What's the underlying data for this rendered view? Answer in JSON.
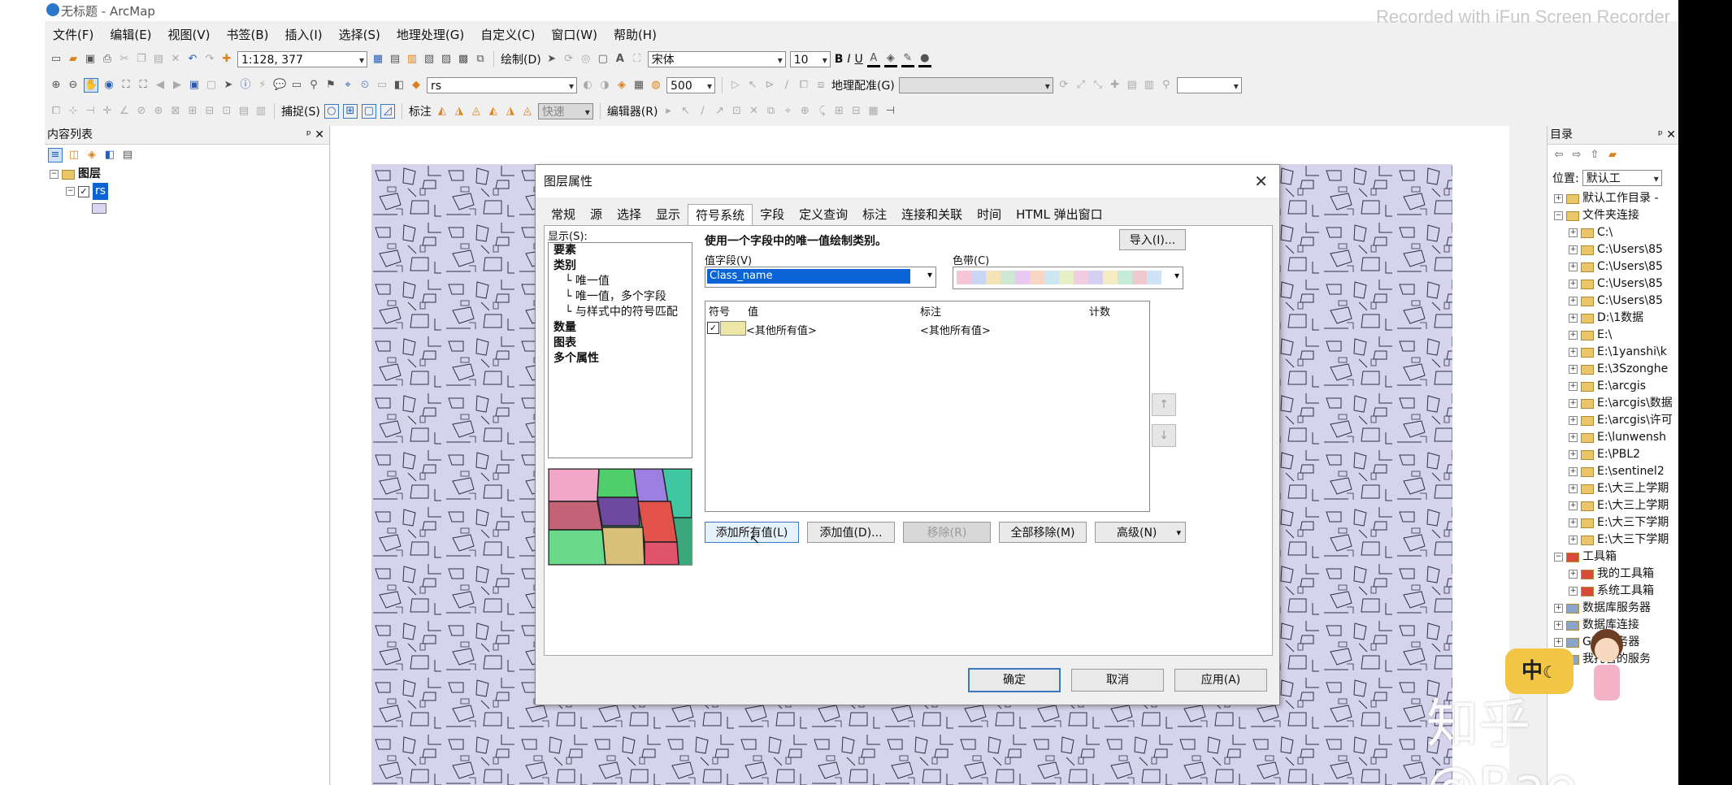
{
  "window": {
    "title": "无标题 - ArcMap",
    "recorder_watermark": "Recorded with iFun Screen Recorder"
  },
  "menu": [
    "文件(F)",
    "编辑(E)",
    "视图(V)",
    "书签(B)",
    "插入(I)",
    "选择(S)",
    "地理处理(G)",
    "自定义(C)",
    "窗口(W)",
    "帮助(H)"
  ],
  "toolbar": {
    "scale": "1:128, 377",
    "draw_label": "绘制(D)",
    "font_name": "宋体",
    "font_size": "10",
    "bold": "B",
    "italic": "I",
    "underline": "U",
    "layer_combo": "rs",
    "resolution": "500",
    "georef_label": "地理配准(G)",
    "snap_label": "捕捉(S)",
    "label_label": "标注",
    "quick_label": "快速",
    "editor_label": "编辑器(R)"
  },
  "toc": {
    "title": "内容列表",
    "root": "图层",
    "layer": "rs"
  },
  "catalog": {
    "title": "目录",
    "location_label": "位置:",
    "location_value": "默认工",
    "items": [
      {
        "label": "默认工作目录 -",
        "level": 0,
        "type": "home"
      },
      {
        "label": "文件夹连接",
        "level": 0,
        "type": "folder",
        "expanded": true
      },
      {
        "label": "C:\\",
        "level": 1,
        "type": "folder"
      },
      {
        "label": "C:\\Users\\85",
        "level": 1,
        "type": "folder"
      },
      {
        "label": "C:\\Users\\85",
        "level": 1,
        "type": "folder"
      },
      {
        "label": "C:\\Users\\85",
        "level": 1,
        "type": "folder"
      },
      {
        "label": "C:\\Users\\85",
        "level": 1,
        "type": "folder"
      },
      {
        "label": "D:\\1数据",
        "level": 1,
        "type": "folder"
      },
      {
        "label": "E:\\",
        "level": 1,
        "type": "folder"
      },
      {
        "label": "E:\\1yanshi\\k",
        "level": 1,
        "type": "folder"
      },
      {
        "label": "E:\\3Szonghe",
        "level": 1,
        "type": "folder"
      },
      {
        "label": "E:\\arcgis",
        "level": 1,
        "type": "folder"
      },
      {
        "label": "E:\\arcgis\\数据",
        "level": 1,
        "type": "folder"
      },
      {
        "label": "E:\\arcgis\\许可",
        "level": 1,
        "type": "folder"
      },
      {
        "label": "E:\\lunwensh",
        "level": 1,
        "type": "folder"
      },
      {
        "label": "E:\\PBL2",
        "level": 1,
        "type": "folder"
      },
      {
        "label": "E:\\sentinel2",
        "level": 1,
        "type": "folder"
      },
      {
        "label": "E:\\大三上学期",
        "level": 1,
        "type": "folder"
      },
      {
        "label": "E:\\大三上学期",
        "level": 1,
        "type": "folder"
      },
      {
        "label": "E:\\大三下学期",
        "level": 1,
        "type": "folder"
      },
      {
        "label": "E:\\大三下学期",
        "level": 1,
        "type": "folder"
      },
      {
        "label": "工具箱",
        "level": 0,
        "type": "toolbox",
        "expanded": true
      },
      {
        "label": "我的工具箱",
        "level": 1,
        "type": "toolbox"
      },
      {
        "label": "系统工具箱",
        "level": 1,
        "type": "toolbox"
      },
      {
        "label": "数据库服务器",
        "level": 0,
        "type": "db"
      },
      {
        "label": "数据库连接",
        "level": 0,
        "type": "db"
      },
      {
        "label": "GIS 服务器",
        "level": 0,
        "type": "db"
      },
      {
        "label": "我托管的服务",
        "level": 0,
        "type": "db"
      }
    ]
  },
  "dialog": {
    "title": "图层属性",
    "tabs": [
      "常规",
      "源",
      "选择",
      "显示",
      "符号系统",
      "字段",
      "定义查询",
      "标注",
      "连接和关联",
      "时间",
      "HTML 弹出窗口"
    ],
    "active_tab": "符号系统",
    "show_label": "显示(S):",
    "show_tree": [
      {
        "label": "要素",
        "bold": true,
        "indent": 0
      },
      {
        "label": "类别",
        "bold": true,
        "indent": 0
      },
      {
        "label": "唯一值",
        "bold": false,
        "indent": 1
      },
      {
        "label": "唯一值，多个字段",
        "bold": false,
        "indent": 1
      },
      {
        "label": "与样式中的符号匹配",
        "bold": false,
        "indent": 1
      },
      {
        "label": "数量",
        "bold": true,
        "indent": 0
      },
      {
        "label": "图表",
        "bold": true,
        "indent": 0
      },
      {
        "label": "多个属性",
        "bold": true,
        "indent": 0
      }
    ],
    "description": "使用一个字段中的唯一值绘制类别。",
    "import_btn": "导入(I)...",
    "value_field_label": "值字段(V)",
    "value_field": "Class_name",
    "color_ramp_label": "色带(C)",
    "color_ramp": [
      "#f7c6d6",
      "#c9d6f5",
      "#f5e3b8",
      "#cfe8d4",
      "#e8c9f0",
      "#f8d5c4",
      "#cde7f2",
      "#e6f0c4",
      "#f2cce0",
      "#d5d0f2",
      "#f5ecc4",
      "#c6ecd8",
      "#f0c9cf",
      "#d0e2f5"
    ],
    "columns": [
      "符号",
      "值",
      "标注",
      "计数"
    ],
    "rows": [
      {
        "value": "<其他所有值>",
        "label": "<其他所有值>",
        "count": "",
        "symbol_color": "#ede7a6"
      }
    ],
    "buttons": {
      "add_all": "添加所有值(L)",
      "add_values": "添加值(D)...",
      "remove": "移除(R)",
      "remove_all": "全部移除(M)",
      "advanced": "高级(N)"
    },
    "ok": "确定",
    "cancel": "取消",
    "apply": "应用(A)"
  },
  "overlay": {
    "ime": "中",
    "brand": "知乎 @Rae"
  },
  "colors": {
    "map_bg": "#d6d4ec",
    "selection": "#0a64d6",
    "dialog_bg": "#f0f0f0"
  }
}
